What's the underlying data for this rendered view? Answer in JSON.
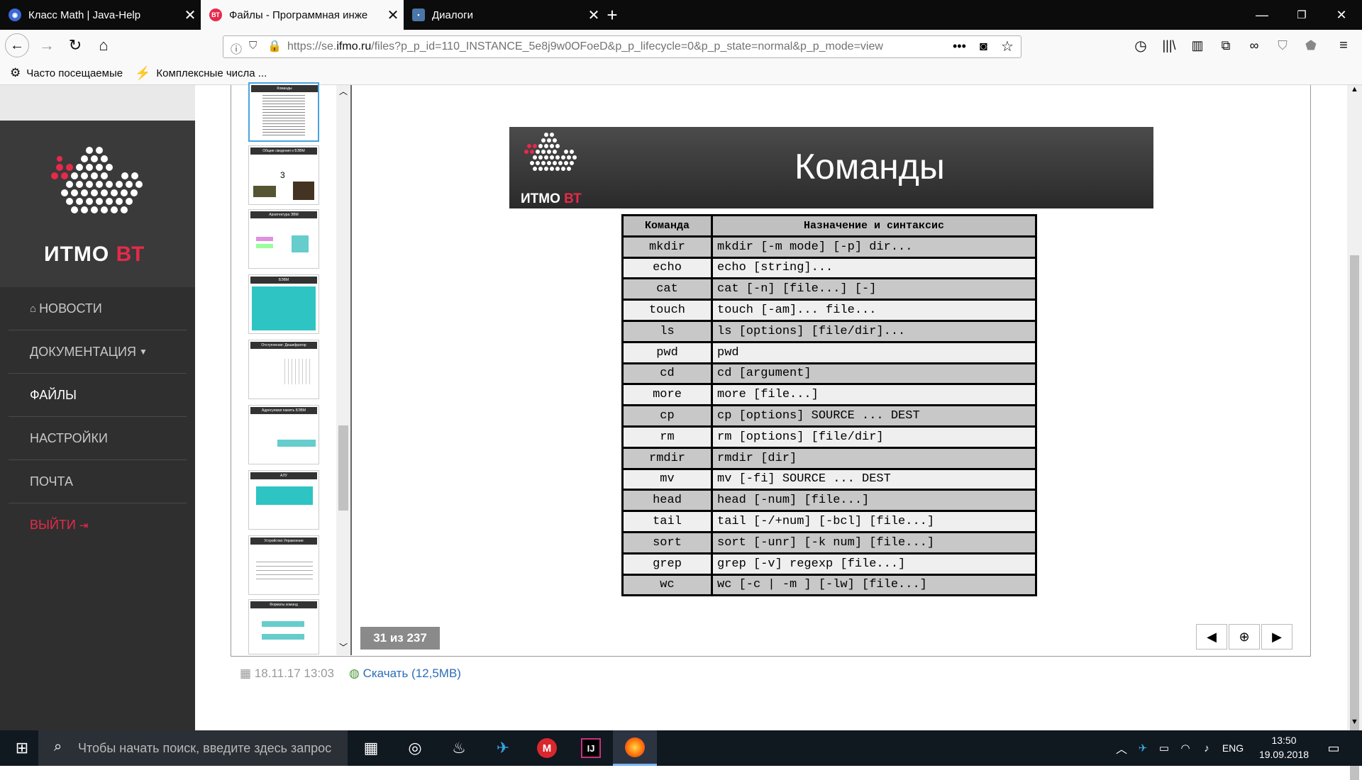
{
  "tabs": [
    {
      "title": "Класс Math | Java-Help",
      "active": false
    },
    {
      "title": "Файлы - Программная инже",
      "active": true
    },
    {
      "title": "Диалоги",
      "active": false
    }
  ],
  "url": {
    "prefix": "https://se.",
    "domain": "ifmo.ru",
    "rest": "/files?p_p_id=110_INSTANCE_5e8j9w0OFoeD&p_p_lifecycle=0&p_p_state=normal&p_p_mode=view"
  },
  "bookmarks": [
    "Часто посещаемые",
    "Комплексные числа ..."
  ],
  "sidebar": {
    "logo_text": "ИТМО",
    "logo_accent": "ВТ",
    "menu": [
      {
        "label": "НОВОСТИ",
        "icon": "home-icon"
      },
      {
        "label": "ДОКУМЕНТАЦИЯ",
        "icon": "caret-down-icon"
      },
      {
        "label": "ФАЙЛЫ",
        "active": true
      },
      {
        "label": "НАСТРОЙКИ"
      },
      {
        "label": "ПОЧТА"
      },
      {
        "label": "ВЫЙТИ",
        "icon": "logout-icon"
      }
    ]
  },
  "thumbs": [
    {
      "title": "Команды"
    },
    {
      "title": "Общие сведения о БЭВМ",
      "number": "3"
    },
    {
      "title": "Архитектура ЭВМ"
    },
    {
      "title": "БЭВМ"
    },
    {
      "title": "Отступление: Дешифратор"
    },
    {
      "title": "Адресуемая память БЭВМ"
    },
    {
      "title": "АЛУ"
    },
    {
      "title": "Устройство Управления"
    },
    {
      "title": "Форматы команд"
    }
  ],
  "slide": {
    "logo_text": "ИТМО",
    "logo_accent": "ВТ",
    "title": "Команды",
    "header": [
      "Команда",
      "Назначение и синтаксис"
    ],
    "rows": [
      [
        "mkdir",
        "mkdir [-m mode] [-p] dir..."
      ],
      [
        "echo",
        "echo [string]..."
      ],
      [
        "cat",
        "cat [-n] [file...] [-]"
      ],
      [
        "touch",
        "touch [-am]... file..."
      ],
      [
        "ls",
        "ls [options] [file/dir]..."
      ],
      [
        "pwd",
        "pwd"
      ],
      [
        "cd",
        "cd [argument]"
      ],
      [
        "more",
        "more [file...]"
      ],
      [
        "cp",
        "cp [options] SOURCE ... DEST"
      ],
      [
        "rm",
        "rm [options] [file/dir]"
      ],
      [
        "rmdir",
        "rmdir [dir]"
      ],
      [
        "mv",
        "mv [-fi] SOURCE ... DEST"
      ],
      [
        "head",
        "head [-num] [file...]"
      ],
      [
        "tail",
        "tail [-/+num] [-bcl] [file...]"
      ],
      [
        "sort",
        "sort [-unr] [-k num] [file...]"
      ],
      [
        "grep",
        "grep [-v] regexp [file...]"
      ],
      [
        "wc",
        "wc [-c | -m ] [-lw] [file...]"
      ]
    ]
  },
  "viewer": {
    "page_indicator": "31 из 237"
  },
  "file_meta": {
    "date": "18.11.17 13:03",
    "download": "Скачать (12,5MB)"
  },
  "taskbar": {
    "search_placeholder": "Чтобы начать поиск, введите здесь запрос",
    "lang": "ENG",
    "time": "13:50",
    "date": "19.09.2018"
  },
  "colors": {
    "accent_red": "#e8294a",
    "sidebar": "#2f2f2f",
    "link": "#2a6eb5"
  }
}
